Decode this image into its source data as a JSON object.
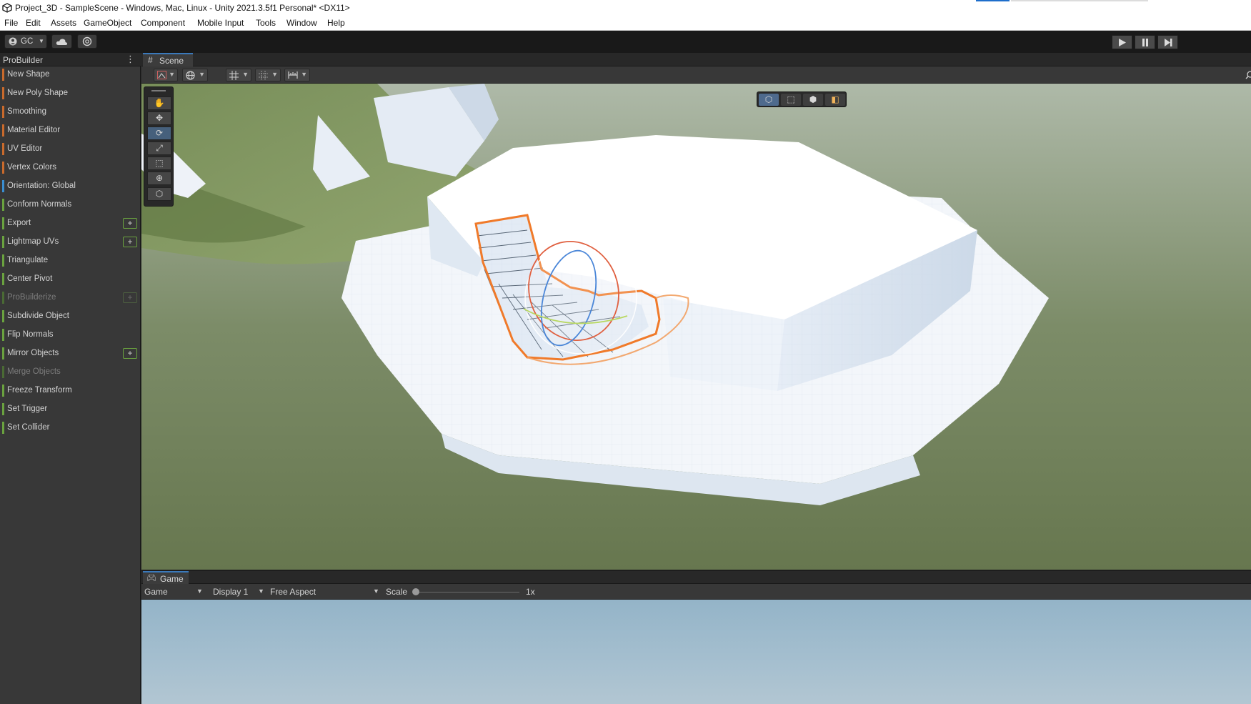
{
  "window": {
    "title": "Project_3D - SampleScene - Windows, Mac, Linux - Unity 2021.3.5f1 Personal* <DX11>"
  },
  "menu": [
    "File",
    "Edit",
    "Assets",
    "GameObject",
    "Component",
    "Mobile Input",
    "Tools",
    "Window",
    "Help"
  ],
  "toolbar": {
    "account_label": "GC",
    "icons": [
      "account-icon",
      "cloud-icon",
      "collab-icon",
      "play-icon",
      "pause-icon",
      "step-icon"
    ]
  },
  "probuilder": {
    "title": "ProBuilder",
    "menu_glyph": "⋮",
    "items": [
      {
        "label": "New Shape",
        "color": "#c96a2c",
        "plus": false,
        "enabled": true
      },
      {
        "label": "New Poly Shape",
        "color": "#c96a2c",
        "plus": false,
        "enabled": true
      },
      {
        "label": "Smoothing",
        "color": "#c96a2c",
        "plus": false,
        "enabled": true
      },
      {
        "label": "Material Editor",
        "color": "#c96a2c",
        "plus": false,
        "enabled": true
      },
      {
        "label": "UV Editor",
        "color": "#c96a2c",
        "plus": false,
        "enabled": true
      },
      {
        "label": "Vertex Colors",
        "color": "#c96a2c",
        "plus": false,
        "enabled": true
      },
      {
        "label": "Orientation: Global",
        "color": "#3a8ed1",
        "plus": false,
        "enabled": true
      },
      {
        "label": "Conform Normals",
        "color": "#6aa23f",
        "plus": false,
        "enabled": true
      },
      {
        "label": "Export",
        "color": "#6aa23f",
        "plus": true,
        "enabled": true
      },
      {
        "label": "Lightmap UVs",
        "color": "#6aa23f",
        "plus": true,
        "enabled": true
      },
      {
        "label": "Triangulate",
        "color": "#6aa23f",
        "plus": false,
        "enabled": true
      },
      {
        "label": "Center Pivot",
        "color": "#6aa23f",
        "plus": false,
        "enabled": true
      },
      {
        "label": "ProBuilderize",
        "color": "#4a6a34",
        "plus": true,
        "enabled": false
      },
      {
        "label": "Subdivide Object",
        "color": "#6aa23f",
        "plus": false,
        "enabled": true
      },
      {
        "label": "Flip Normals",
        "color": "#6aa23f",
        "plus": false,
        "enabled": true
      },
      {
        "label": "Mirror Objects",
        "color": "#6aa23f",
        "plus": true,
        "enabled": true
      },
      {
        "label": "Merge Objects",
        "color": "#4a6a34",
        "plus": false,
        "enabled": false
      },
      {
        "label": "Freeze Transform",
        "color": "#6aa23f",
        "plus": false,
        "enabled": true
      },
      {
        "label": "Set Trigger",
        "color": "#6aa23f",
        "plus": false,
        "enabled": true
      },
      {
        "label": "Set Collider",
        "color": "#6aa23f",
        "plus": false,
        "enabled": true
      }
    ]
  },
  "scene": {
    "tab_label": "Scene",
    "tab_icon": "#",
    "tools": [
      "hand-tool-icon",
      "move-tool-icon",
      "rotate-tool-icon",
      "scale-tool-icon",
      "rect-tool-icon",
      "transform-tool-icon",
      "custom-tool-icon"
    ],
    "active_tool": "rotate-tool-icon",
    "pb_modes": [
      "object-mode-icon",
      "vertex-mode-icon",
      "edge-mode-icon",
      "face-mode-icon"
    ],
    "selected_mode": "object-mode-icon",
    "selection_color": "#f07a2a"
  },
  "game": {
    "tab_label": "Game",
    "display_mode": "Game",
    "display": "Display 1",
    "aspect": "Free Aspect",
    "scale_label": "Scale",
    "scale_value": "1x"
  }
}
